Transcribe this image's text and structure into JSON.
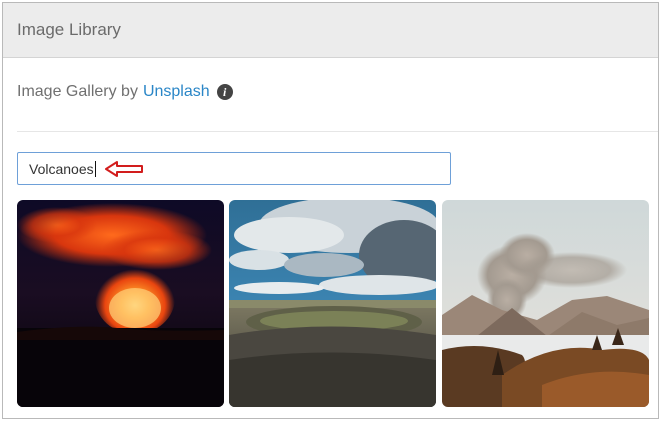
{
  "header": {
    "title": "Image Library"
  },
  "gallery": {
    "prefix": "Image Gallery by",
    "link": "Unsplash",
    "info_glyph": "i"
  },
  "search": {
    "value": "Volcanoes"
  },
  "images": [
    {
      "subject": "lava-eruption-night"
    },
    {
      "subject": "crater-under-cloudy-sky"
    },
    {
      "subject": "smoking-volcano-landscape"
    }
  ]
}
